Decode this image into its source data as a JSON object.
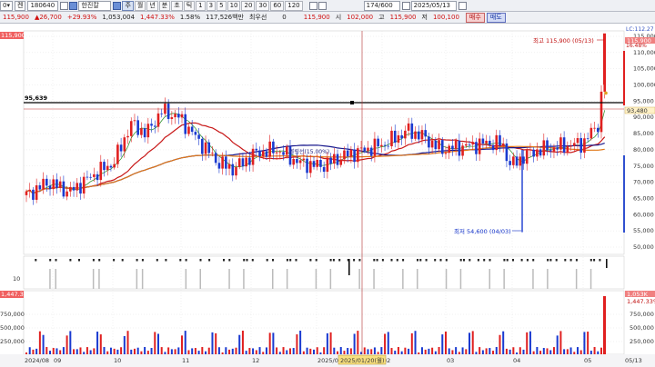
{
  "toolbar": {
    "market_code": "0",
    "market_label": "켄",
    "stock_code": "180640",
    "stock_name": "한진칼",
    "period_buttons": [
      "주",
      "월",
      "년",
      "분",
      "초",
      "틱"
    ],
    "minute_buttons": [
      "1",
      "3",
      "5",
      "10",
      "20",
      "30",
      "60",
      "120"
    ],
    "count": "174/600",
    "date": "2025/05/13"
  },
  "quote": {
    "price": "115,900",
    "change": "26,700",
    "change_pct": "+29.93%",
    "volume": "1,053,004",
    "volume_ratio": "1,447.33%",
    "turnover_rate": "1.58%",
    "amount": "117,526백만",
    "priority_label": "최우선",
    "priority_value": "0",
    "current": "115,900",
    "open_label": "시",
    "open": "102,000",
    "high_label": "고",
    "high": "115,900",
    "low_label": "저",
    "low": "100,100",
    "buy_label": "매수",
    "sell_label": "매도"
  },
  "chart": {
    "top_right_label": "LC:112.27",
    "pct_label": "16.48%",
    "hline_label": "95,639",
    "hline_right_label": "93,480",
    "high_marker_label": "최고 115,900 (05/13)",
    "low_marker_label": "최저 54,600 (04/03)",
    "ma_label": "볼링선(15.00%)",
    "price_axis": [
      "115,000",
      "110,000",
      "105,000",
      "100,000",
      "95,000",
      "90,000",
      "85,000",
      "80,000",
      "75,000",
      "70,000",
      "65,000",
      "60,000",
      "55,000",
      "50,000"
    ],
    "price_axis_top": "115,900",
    "price_axis_left_top": "115,900",
    "osc_axis": [
      "10"
    ],
    "volume_axis": [
      "1,447.33%",
      "750,000",
      "500,000",
      "250,000"
    ],
    "volume_axis_top": "1,053K",
    "x_labels": [
      "2024/08",
      "09",
      "10",
      "11",
      "12",
      "2025/01",
      "02",
      "03",
      "04",
      "05",
      "05/13"
    ],
    "crosshair_date": "2025/01/20(월)",
    "colors": {
      "up": "#e02020",
      "down": "#1a3ad0",
      "ma_red": "#c81818",
      "ma_blue": "#18188c",
      "ma_orange": "#e07818",
      "ma_green": "#208c20"
    }
  }
}
